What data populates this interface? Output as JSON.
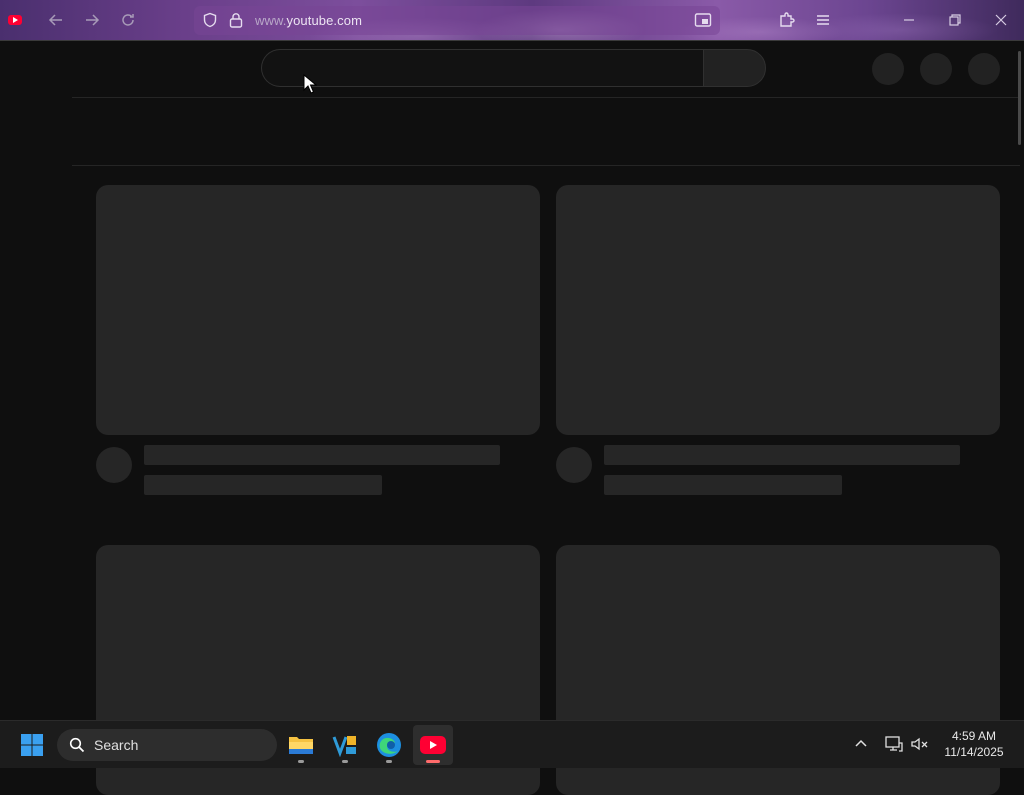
{
  "browser": {
    "url_prefix": "www.",
    "url_domain": "youtube.com"
  },
  "taskbar": {
    "search_label": "Search",
    "apps": [
      "file-explorer",
      "visual-studio",
      "microsoft-edge",
      "youtube"
    ],
    "clock_time": "4:59 AM",
    "clock_date": "11/14/2025"
  },
  "colors": {
    "page_background": "#0f0f0f",
    "skeleton": "#262626",
    "youtube_red": "#ff0033",
    "chrome_purple": "#6a3f8a"
  }
}
